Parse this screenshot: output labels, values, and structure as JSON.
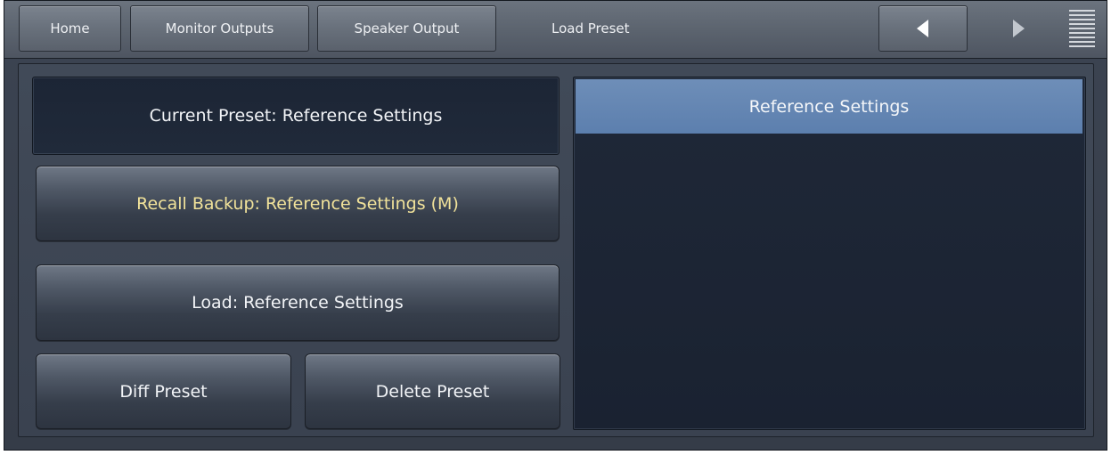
{
  "nav": {
    "home_label": "Home",
    "monitor_outputs_label": "Monitor Outputs",
    "speaker_output_label": "Speaker Output",
    "page_title": "Load Preset",
    "back_icon": "triangle-left-icon",
    "forward_icon": "triangle-right-icon",
    "menu_icon": "menu-grip-icon"
  },
  "preset": {
    "current_label": "Current Preset: Reference Settings",
    "recall_backup_label": "Recall Backup: Reference Settings (M)",
    "load_label": "Load: Reference Settings",
    "diff_label": "Diff Preset",
    "delete_label": "Delete Preset"
  },
  "preset_list": {
    "items": [
      {
        "label": "Reference Settings",
        "selected": true
      }
    ]
  },
  "colors": {
    "recall_text": "#f1e29a",
    "selected_row": "#5c7fae",
    "panel_dark": "#1c2535"
  }
}
